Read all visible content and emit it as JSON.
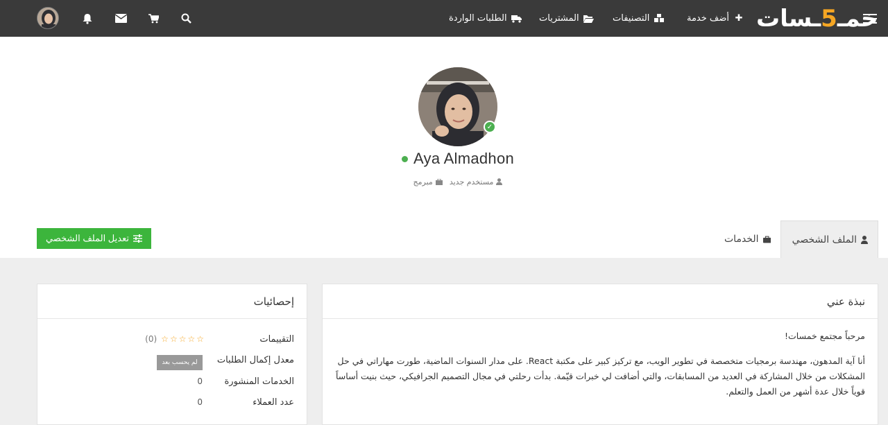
{
  "navbar": {
    "logo_main": "خمسات",
    "logo_accent": "5",
    "add_service": "أضف خدمة",
    "categories": "التصنيفات",
    "purchases": "المشتريات",
    "incoming_orders": "الطلبات الواردة",
    "icons": [
      "menu-icon",
      "plus-icon",
      "cubes-icon",
      "folder-open-icon",
      "truck-icon",
      "search-icon",
      "cart-icon",
      "envelope-icon",
      "bell-icon"
    ]
  },
  "profile": {
    "name": "Aya Almadhon",
    "status": "online",
    "verified": true,
    "user_type": "مستخدم جديد",
    "role": "مبرمج"
  },
  "tabs": [
    {
      "label": "الملف الشخصي",
      "active": true
    },
    {
      "label": "الخدمات",
      "active": false
    }
  ],
  "edit_profile_label": "تعديل الملف الشخصي",
  "about": {
    "title": "نبذة عني",
    "greeting": "مرحباً مجتمع خمسات!",
    "paragraph": "أنا آية المدهون، مهندسة برمجيات متخصصة في تطوير الويب، مع تركيز كبير على مكتبة React. على مدار السنوات الماضية، طورت مهاراتي في حل المشكلات من خلال المشاركة في العديد من المسابقات، والتي أضافت لي خبرات قيّمة. بدأت رحلتي في مجال التصميم الجرافيكي، حيث بنيت أساساً قوياً خلال عدة أشهر من العمل والتعلم."
  },
  "stats": {
    "title": "إحصائيات",
    "ratings_label": "التقييمات",
    "ratings_count": "(0)",
    "ratings_stars": 0,
    "completion_label": "معدل إكمال الطلبات",
    "completion_value": "لم يحسب بعد",
    "published_label": "الخدمات المنشورة",
    "published_value": "0",
    "clients_label": "عدد العملاء",
    "clients_value": "0"
  },
  "colors": {
    "navbar": "#3a3a3a",
    "accent": "#f5a623",
    "green": "#3cb53c",
    "online": "#4caf50"
  }
}
